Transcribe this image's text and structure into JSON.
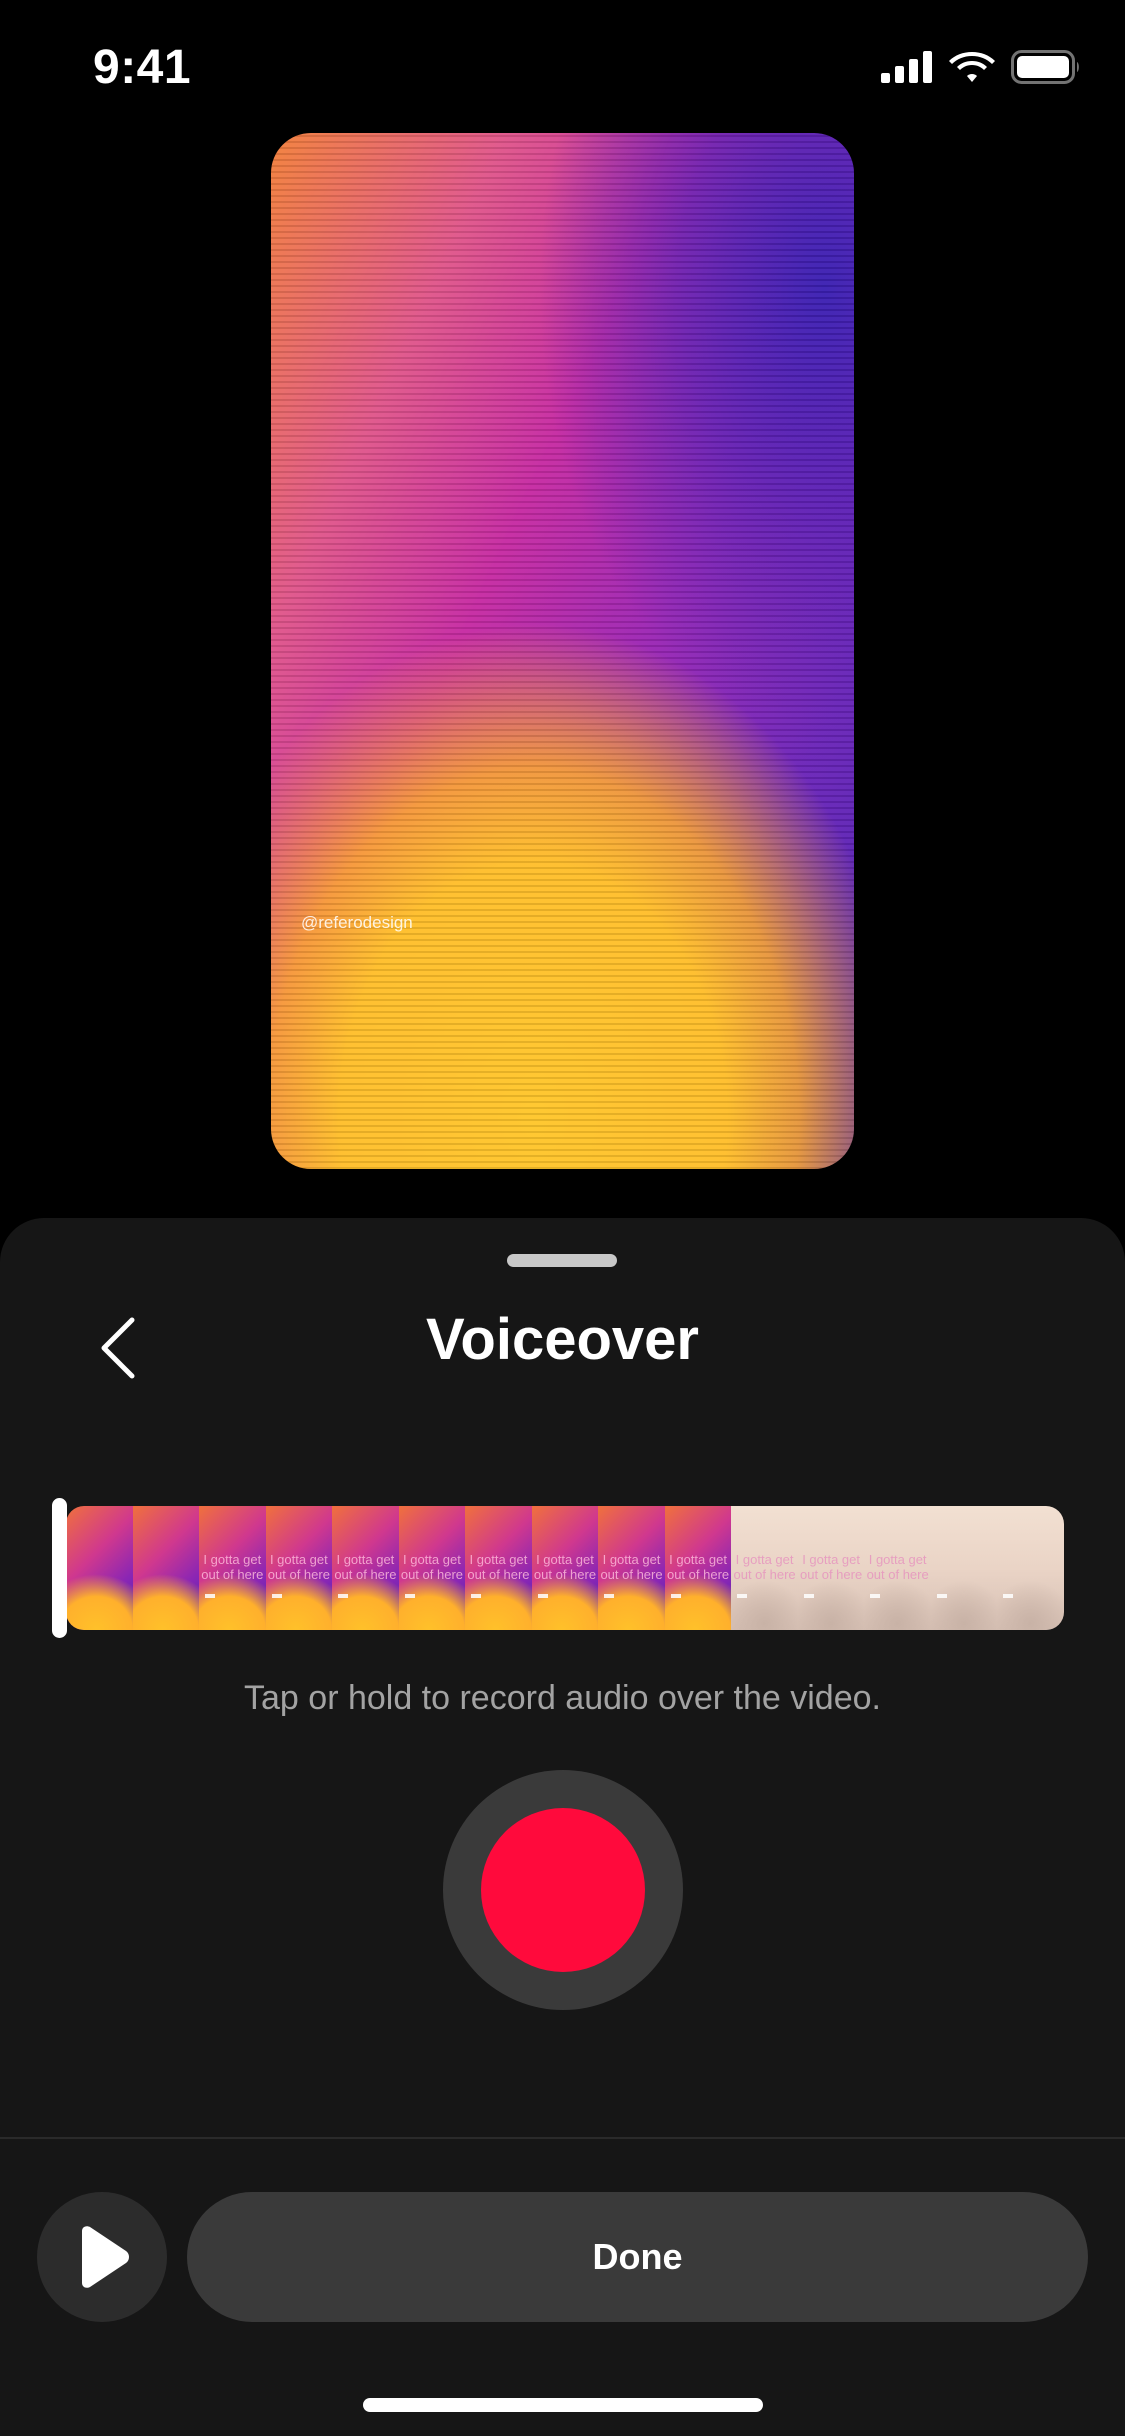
{
  "status_bar": {
    "time": "9:41",
    "icons": [
      "cellular-signal-icon",
      "wifi-icon",
      "battery-icon"
    ]
  },
  "preview": {
    "watermark": "@referodesign"
  },
  "sheet": {
    "title": "Voiceover",
    "back_icon": "chevron-left-icon",
    "hint": "Tap or hold to record audio over the video.",
    "done_label": "Done",
    "play_icon": "play-icon"
  },
  "timeline": {
    "frames": [
      {
        "style": "vivid",
        "text": ""
      },
      {
        "style": "vivid",
        "text": ""
      },
      {
        "style": "vivid",
        "text": "I gotta get out of here"
      },
      {
        "style": "vivid",
        "text": "I gotta get out of here"
      },
      {
        "style": "vivid",
        "text": "I gotta get out of here"
      },
      {
        "style": "vivid",
        "text": "I gotta get out of here"
      },
      {
        "style": "vivid",
        "text": "I gotta get out of here"
      },
      {
        "style": "vivid",
        "text": "I gotta get out of here"
      },
      {
        "style": "vivid",
        "text": "I gotta get out of here"
      },
      {
        "style": "vivid",
        "text": "I gotta get out of here"
      },
      {
        "style": "pale",
        "text": "I gotta get out of here"
      },
      {
        "style": "pale",
        "text": "I gotta get out of here"
      },
      {
        "style": "pale",
        "text": "I gotta get out of here"
      },
      {
        "style": "pale",
        "text": ""
      },
      {
        "style": "pale",
        "text": ""
      }
    ]
  },
  "colors": {
    "record": "#ff0a3c",
    "sheet_background": "#161616",
    "button_background": "#3a3a3a"
  }
}
